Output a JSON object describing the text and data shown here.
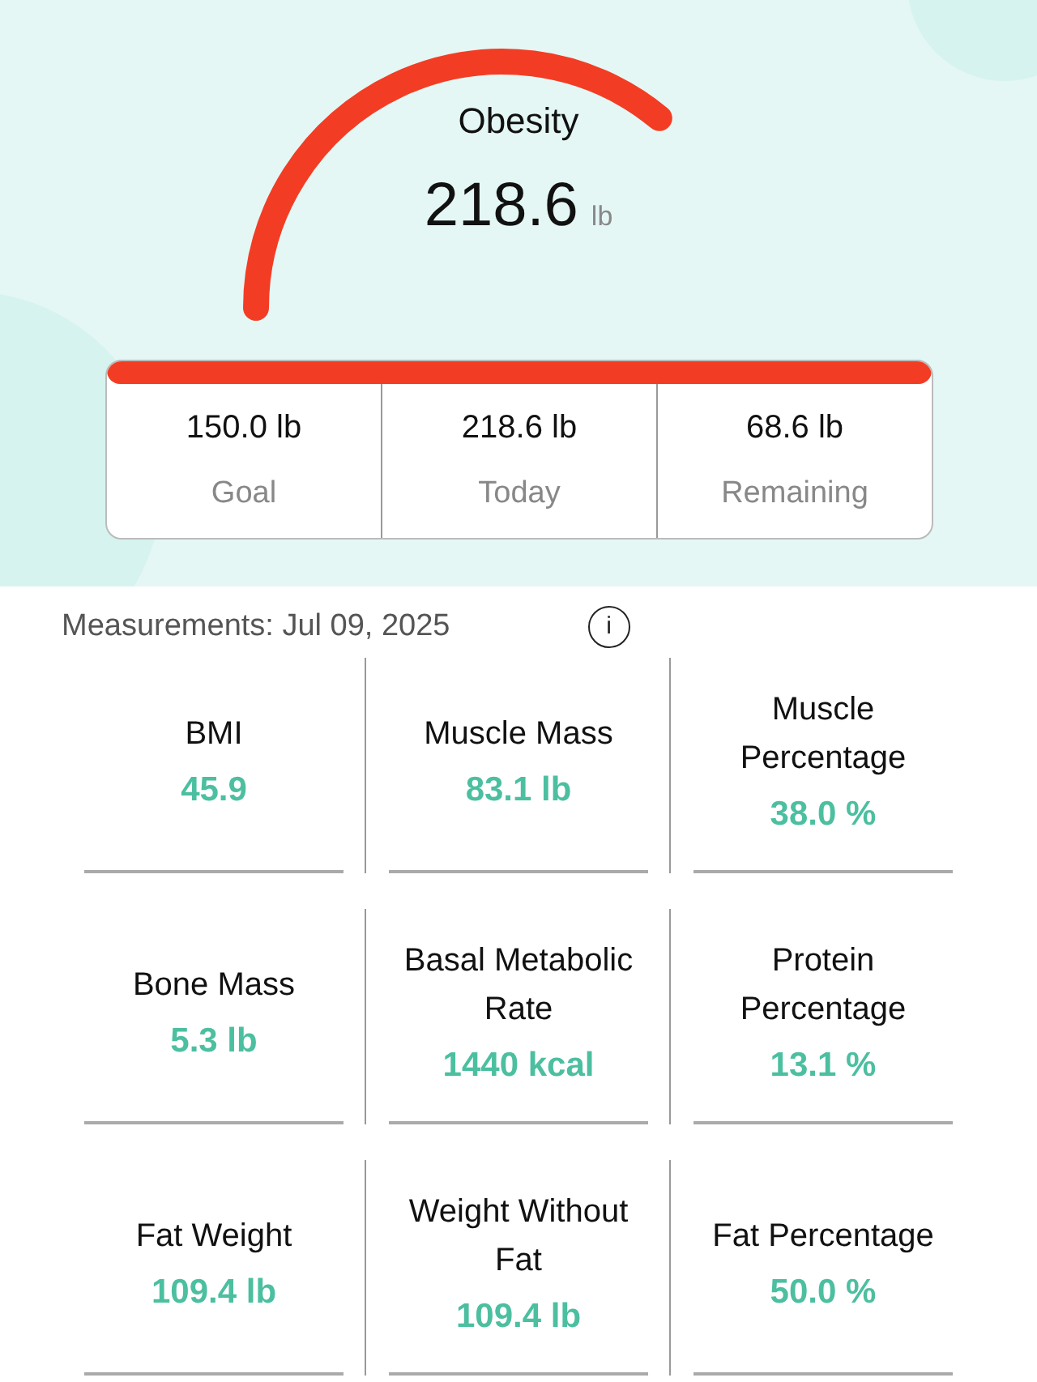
{
  "gauge": {
    "status": "Obesity",
    "value": "218.6",
    "unit": "lb"
  },
  "summary": [
    {
      "value": "150.0 lb",
      "label": "Goal"
    },
    {
      "value": "218.6 lb",
      "label": "Today"
    },
    {
      "value": "68.6 lb",
      "label": "Remaining"
    }
  ],
  "measurements": {
    "title": "Measurements: Jul 09, 2025",
    "info": "i",
    "items": [
      {
        "label": "BMI",
        "value": "45.9"
      },
      {
        "label": "Muscle Mass",
        "value": "83.1 lb"
      },
      {
        "label": "Muscle Percentage",
        "value": "38.0 %"
      },
      {
        "label": "Bone Mass",
        "value": "5.3 lb"
      },
      {
        "label": "Basal Metabolic Rate",
        "value": "1440 kcal"
      },
      {
        "label": "Protein Percentage",
        "value": "13.1 %"
      },
      {
        "label": "Fat Weight",
        "value": "109.4 lb"
      },
      {
        "label": "Weight Without Fat",
        "value": "109.4 lb"
      },
      {
        "label": "Fat Percentage",
        "value": "50.0 %"
      }
    ]
  }
}
